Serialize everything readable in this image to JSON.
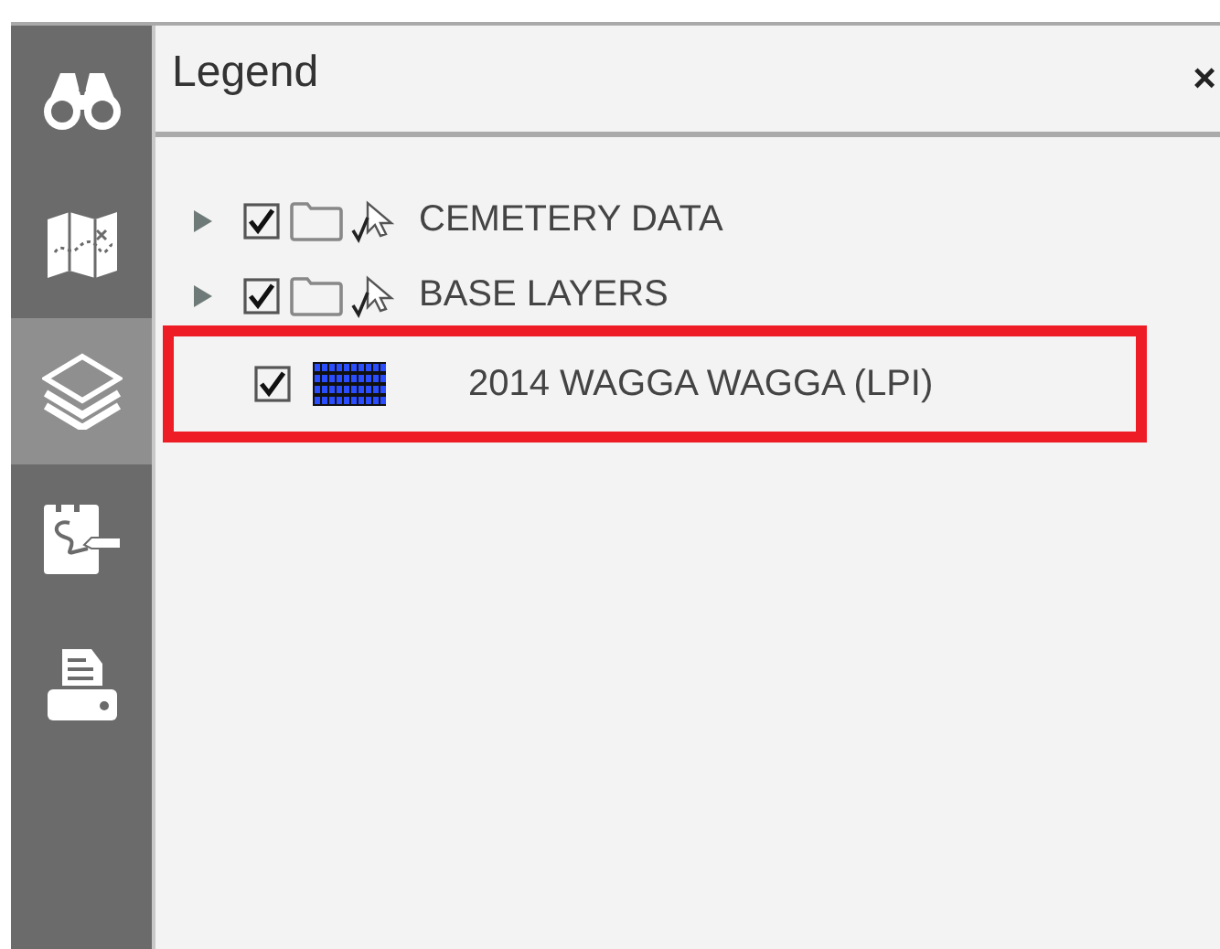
{
  "sidebar": {
    "items": [
      {
        "kind": "binoculars",
        "selected": false
      },
      {
        "kind": "map",
        "selected": false
      },
      {
        "kind": "layers",
        "selected": true
      },
      {
        "kind": "notebook",
        "selected": false
      },
      {
        "kind": "printer",
        "selected": false
      }
    ]
  },
  "panel": {
    "title": "Legend",
    "close": "×"
  },
  "legend": {
    "items": [
      {
        "kind": "group",
        "label": "CEMETERY DATA",
        "checked": true,
        "expanded": false,
        "highlighted": false
      },
      {
        "kind": "group",
        "label": "BASE LAYERS",
        "checked": true,
        "expanded": false,
        "highlighted": false
      },
      {
        "kind": "layer",
        "label": "2014 WAGGA WAGGA (LPI)",
        "checked": true,
        "highlighted": true
      }
    ]
  }
}
